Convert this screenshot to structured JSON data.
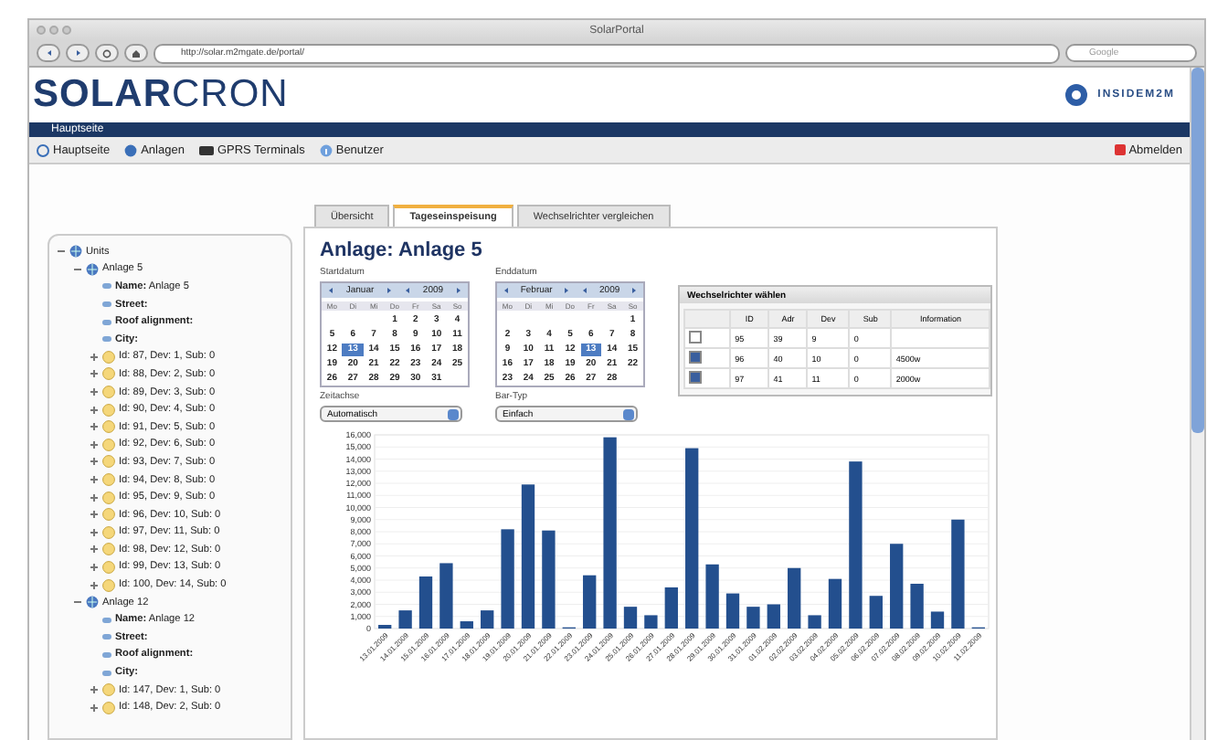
{
  "browser": {
    "title": "SolarPortal",
    "url": "http://solar.m2mgate.de/portal/",
    "search": {
      "placeholder": "Google"
    }
  },
  "header": {
    "logo": "**SOLAR**CRON",
    "partner_logo": "INSIDEM2M"
  },
  "breadcrumb": "Hauptseite",
  "nav": [
    {
      "label": "Hauptseite",
      "kind": "home"
    },
    {
      "label": "Anlagen",
      "kind": "globe"
    },
    {
      "label": "GPRS Terminals",
      "kind": "terminal"
    },
    {
      "label": "Benutzer",
      "kind": "info"
    }
  ],
  "logout": "Abmelden",
  "tree": {
    "label": "Units",
    "kind": "group",
    "expanded": true,
    "children": [
      {
        "label": "Anlage 5",
        "kind": "group",
        "expanded": true,
        "children": [
          {
            "label": "**Name:** Anlage 5",
            "kind": "property"
          },
          {
            "label": "**Street:**",
            "kind": "property"
          },
          {
            "label": "**Roof alignment:**",
            "kind": "property"
          },
          {
            "label": "**City:**",
            "kind": "property"
          },
          {
            "label": "Id: 87, Dev: 1, Sub: 0",
            "kind": "device",
            "expanded": false
          },
          {
            "label": "Id: 88, Dev: 2, Sub: 0",
            "kind": "device",
            "expanded": false
          },
          {
            "label": "Id: 89, Dev: 3, Sub: 0",
            "kind": "device",
            "expanded": false
          },
          {
            "label": "Id: 90, Dev: 4, Sub: 0",
            "kind": "device",
            "expanded": false
          },
          {
            "label": "Id: 91, Dev: 5, Sub: 0",
            "kind": "device",
            "expanded": false
          },
          {
            "label": "Id: 92, Dev: 6, Sub: 0",
            "kind": "device",
            "expanded": false
          },
          {
            "label": "Id: 93, Dev: 7, Sub: 0",
            "kind": "device",
            "expanded": false
          },
          {
            "label": "Id: 94, Dev: 8, Sub: 0",
            "kind": "device",
            "expanded": false
          },
          {
            "label": "Id: 95, Dev: 9, Sub: 0",
            "kind": "device",
            "expanded": false
          },
          {
            "label": "Id: 96, Dev: 10, Sub: 0",
            "kind": "device",
            "expanded": false
          },
          {
            "label": "Id: 97, Dev: 11, Sub: 0",
            "kind": "device",
            "expanded": false
          },
          {
            "label": "Id: 98, Dev: 12, Sub: 0",
            "kind": "device",
            "expanded": false
          },
          {
            "label": "Id: 99, Dev: 13, Sub: 0",
            "kind": "device",
            "expanded": false
          },
          {
            "label": "Id: 100, Dev: 14, Sub: 0",
            "kind": "device",
            "expanded": false
          }
        ]
      },
      {
        "label": "Anlage 12",
        "kind": "group",
        "expanded": true,
        "children": [
          {
            "label": "**Name:** Anlage 12",
            "kind": "property"
          },
          {
            "label": "**Street:**",
            "kind": "property"
          },
          {
            "label": "**Roof alignment:**",
            "kind": "property"
          },
          {
            "label": "**City:**",
            "kind": "property"
          },
          {
            "label": "Id: 147, Dev: 1, Sub: 0",
            "kind": "device",
            "expanded": false
          },
          {
            "label": "Id: 148, Dev: 2, Sub: 0",
            "kind": "device",
            "expanded": false
          }
        ]
      }
    ]
  },
  "tabs": [
    {
      "label": "Übersicht",
      "selected": false
    },
    {
      "label": "Tageseinspeisung",
      "selected": true
    },
    {
      "label": "Wechselrichter vergleichen",
      "selected": false
    }
  ],
  "title": "Anlage: Anlage 5",
  "calendars": [
    {
      "label": "Startdatum",
      "month": "Januar",
      "year": "2009",
      "weekdays": [
        "Mo",
        "Di",
        "Mi",
        "Do",
        "Fr",
        "Sa",
        "So"
      ],
      "weeks": [
        [
          {
            "day": "1",
            "selected": false
          },
          {
            "day": "2",
            "selected": false
          },
          {
            "day": "3",
            "selected": false
          },
          {
            "day": "4",
            "selected": false
          }
        ],
        [
          {
            "day": "5",
            "selected": false
          },
          {
            "day": "6",
            "selected": false
          },
          {
            "day": "7",
            "selected": false
          },
          {
            "day": "8",
            "selected": false
          },
          {
            "day": "9",
            "selected": false
          },
          {
            "day": "10",
            "selected": false
          },
          {
            "day": "11",
            "selected": false
          }
        ],
        [
          {
            "day": "12",
            "selected": false
          },
          {
            "day": "13",
            "selected": true
          },
          {
            "day": "14",
            "selected": false
          },
          {
            "day": "15",
            "selected": false
          },
          {
            "day": "16",
            "selected": false
          },
          {
            "day": "17",
            "selected": false
          },
          {
            "day": "18",
            "selected": false
          }
        ],
        [
          {
            "day": "19",
            "selected": false
          },
          {
            "day": "20",
            "selected": false
          },
          {
            "day": "21",
            "selected": false
          },
          {
            "day": "22",
            "selected": false
          },
          {
            "day": "23",
            "selected": false
          },
          {
            "day": "24",
            "selected": false
          },
          {
            "day": "25",
            "selected": false
          }
        ],
        [
          {
            "day": "26",
            "selected": false
          },
          {
            "day": "27",
            "selected": false
          },
          {
            "day": "28",
            "selected": false
          },
          {
            "day": "29",
            "selected": false
          },
          {
            "day": "30",
            "selected": false
          },
          {
            "day": "31",
            "selected": false
          }
        ]
      ]
    },
    {
      "label": "Enddatum",
      "month": "Februar",
      "year": "2009",
      "weekdays": [
        "Mo",
        "Di",
        "Mi",
        "Do",
        "Fr",
        "Sa",
        "So"
      ],
      "weeks": [
        [
          {
            "day": "1",
            "selected": false
          }
        ],
        [
          {
            "day": "2",
            "selected": false
          },
          {
            "day": "3",
            "selected": false
          },
          {
            "day": "4",
            "selected": false
          },
          {
            "day": "5",
            "selected": false
          },
          {
            "day": "6",
            "selected": false
          },
          {
            "day": "7",
            "selected": false
          },
          {
            "day": "8",
            "selected": false
          }
        ],
        [
          {
            "day": "9",
            "selected": false
          },
          {
            "day": "10",
            "selected": false
          },
          {
            "day": "11",
            "selected": false
          },
          {
            "day": "12",
            "selected": false
          },
          {
            "day": "13",
            "selected": true
          },
          {
            "day": "14",
            "selected": false
          },
          {
            "day": "15",
            "selected": false
          }
        ],
        [
          {
            "day": "16",
            "selected": false
          },
          {
            "day": "17",
            "selected": false
          },
          {
            "day": "18",
            "selected": false
          },
          {
            "day": "19",
            "selected": false
          },
          {
            "day": "20",
            "selected": false
          },
          {
            "day": "21",
            "selected": false
          },
          {
            "day": "22",
            "selected": false
          }
        ],
        [
          {
            "day": "23",
            "selected": false
          },
          {
            "day": "24",
            "selected": false
          },
          {
            "day": "25",
            "selected": false
          },
          {
            "day": "26",
            "selected": false
          },
          {
            "day": "27",
            "selected": false
          },
          {
            "day": "28",
            "selected": false
          }
        ]
      ]
    }
  ],
  "selects": [
    {
      "label": "Zeitachse",
      "value": "Automatisch"
    },
    {
      "label": "Bar-Typ",
      "value": "Einfach"
    }
  ],
  "inverters": {
    "title": "Wechselrichter wählen",
    "columns": [
      "ID",
      "Adr",
      "Dev",
      "Sub",
      "Information"
    ],
    "rows": [
      {
        "checked": false,
        "cells": [
          "95",
          "39",
          "9",
          "0"
        ]
      },
      {
        "checked": true,
        "cells": [
          "96",
          "40",
          "10",
          "0",
          "4500w"
        ]
      },
      {
        "checked": true,
        "cells": [
          "97",
          "41",
          "11",
          "0",
          "2000w"
        ]
      }
    ]
  },
  "chart_data": {
    "type": "bar",
    "categories": [
      "13.01.2009",
      "14.01.2009",
      "15.01.2009",
      "16.01.2009",
      "17.01.2009",
      "18.01.2009",
      "19.01.2009",
      "20.01.2009",
      "21.01.2009",
      "22.01.2009",
      "23.01.2009",
      "24.01.2009",
      "25.01.2009",
      "26.01.2009",
      "27.01.2009",
      "28.01.2009",
      "29.01.2009",
      "30.01.2009",
      "31.01.2009",
      "01.02.2009",
      "02.02.2009",
      "03.02.2009",
      "04.02.2009",
      "05.02.2009",
      "06.02.2009",
      "07.02.2009",
      "08.02.2009",
      "09.02.2009",
      "10.02.2009",
      "11.02.2009"
    ],
    "grid": true,
    "series": [
      {
        "color": "#234f8e",
        "values": [
          300,
          1500,
          4300,
          5400,
          600,
          1500,
          8200,
          11900,
          8100,
          100,
          4400,
          15800,
          1800,
          1100,
          3400,
          14900,
          5300,
          2900,
          1800,
          2000,
          5000,
          1100,
          4100,
          13800,
          2700,
          7000,
          3700,
          1400,
          9000,
          100
        ]
      }
    ],
    "ylim": [
      0,
      16000
    ],
    "yticks": [
      {
        "value": 0,
        "label": "0"
      },
      {
        "value": 1000,
        "label": "1,000"
      },
      {
        "value": 2000,
        "label": "2,000"
      },
      {
        "value": 3000,
        "label": "3,000"
      },
      {
        "value": 4000,
        "label": "4,000"
      },
      {
        "value": 5000,
        "label": "5,000"
      },
      {
        "value": 6000,
        "label": "6,000"
      },
      {
        "value": 7000,
        "label": "7,000"
      },
      {
        "value": 8000,
        "label": "8,000"
      },
      {
        "value": 9000,
        "label": "9,000"
      },
      {
        "value": 10000,
        "label": "10,000"
      },
      {
        "value": 11000,
        "label": "11,000"
      },
      {
        "value": 12000,
        "label": "12,000"
      },
      {
        "value": 13000,
        "label": "13,000"
      },
      {
        "value": 14000,
        "label": "14,000"
      },
      {
        "value": 15000,
        "label": "15,000"
      },
      {
        "value": 16000,
        "label": "16,000"
      }
    ]
  }
}
